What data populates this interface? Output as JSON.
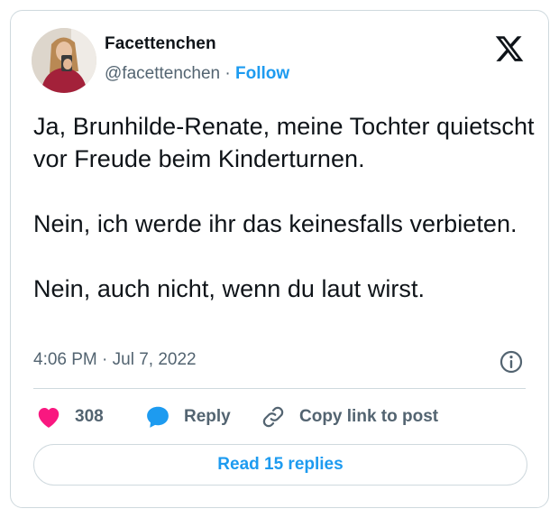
{
  "author": {
    "display_name": "Facettenchen",
    "handle": "@facettenchen",
    "separator": " · ",
    "follow_label": "Follow"
  },
  "tweet": {
    "paragraphs": [
      "Ja, Brunhilde-Renate, meine Tochter quietscht vor Freude beim Kinderturnen.",
      "Nein, ich werde ihr das keinesfalls verbieten.",
      "Nein, auch nicht, wenn du laut wirst."
    ],
    "timestamp": "4:06 PM · Jul 7, 2022"
  },
  "actions": {
    "like_count": "308",
    "reply_label": "Reply",
    "copy_label": "Copy link to post"
  },
  "footer": {
    "read_replies_label": "Read 15 replies"
  },
  "icons": {
    "logo": "x-logo-icon",
    "info": "info-icon",
    "like": "heart-icon",
    "reply": "speech-bubble-icon",
    "copy": "link-icon"
  },
  "colors": {
    "accent": "#1d9bf0",
    "like": "#f91880",
    "text": "#0f1419",
    "secondary": "#536471",
    "border": "#cfd9de"
  }
}
